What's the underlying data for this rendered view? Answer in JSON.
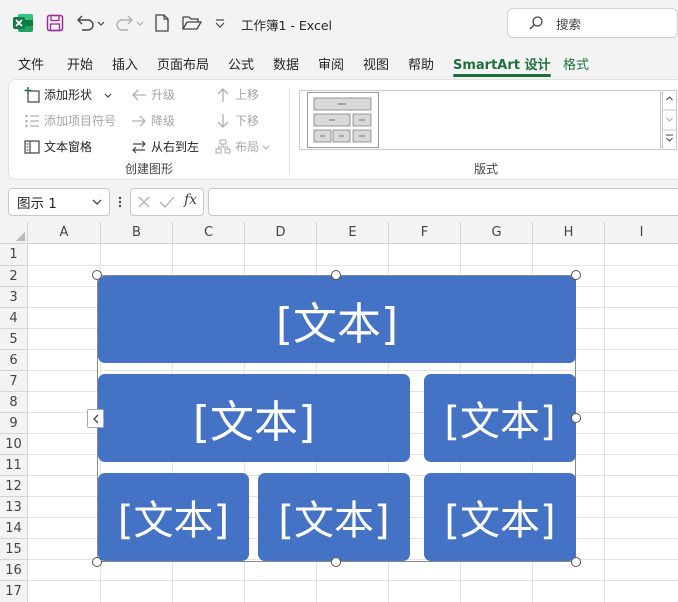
{
  "title_bar": {
    "document_title": "工作簿1  -  Excel",
    "search_placeholder": "搜索"
  },
  "menu": {
    "tabs": [
      {
        "label": "文件"
      },
      {
        "label": "开始"
      },
      {
        "label": "插入"
      },
      {
        "label": "页面布局"
      },
      {
        "label": "公式"
      },
      {
        "label": "数据"
      },
      {
        "label": "审阅"
      },
      {
        "label": "视图"
      },
      {
        "label": "帮助"
      },
      {
        "label": "SmartArt 设计",
        "active": true
      },
      {
        "label": "格式"
      }
    ]
  },
  "ribbon": {
    "create_graphic": {
      "add_shape": "添加形状",
      "add_bullet": "添加项目符号",
      "text_pane": "文本窗格",
      "promote": "升级",
      "demote": "降级",
      "right_to_left": "从右到左",
      "move_up": "上移",
      "move_down": "下移",
      "layout": "布局",
      "group_label": "创建图形"
    },
    "layouts": {
      "group_label": "版式"
    }
  },
  "formula_bar": {
    "name_box": "图示 1",
    "fx": "fx",
    "formula": ""
  },
  "sheet": {
    "columns": [
      "A",
      "B",
      "C",
      "D",
      "E",
      "F",
      "G",
      "H",
      "I"
    ],
    "rows": [
      "1",
      "2",
      "3",
      "4",
      "5",
      "6",
      "7",
      "8",
      "9",
      "10",
      "11",
      "12",
      "13",
      "14",
      "15",
      "16",
      "17"
    ]
  },
  "smartart": {
    "fill_color": "#4472c4",
    "text_color": "#ffffff",
    "nodes": [
      {
        "text": "[文本]"
      },
      {
        "text": "[文本]"
      },
      {
        "text": "[文本]"
      },
      {
        "text": "[文本]"
      },
      {
        "text": "[文本]"
      },
      {
        "text": "[文本]"
      }
    ]
  },
  "colors": {
    "accent_green": "#1e6f3e",
    "excel_green": "#107c41",
    "save_purple": "#9b2d9b"
  }
}
